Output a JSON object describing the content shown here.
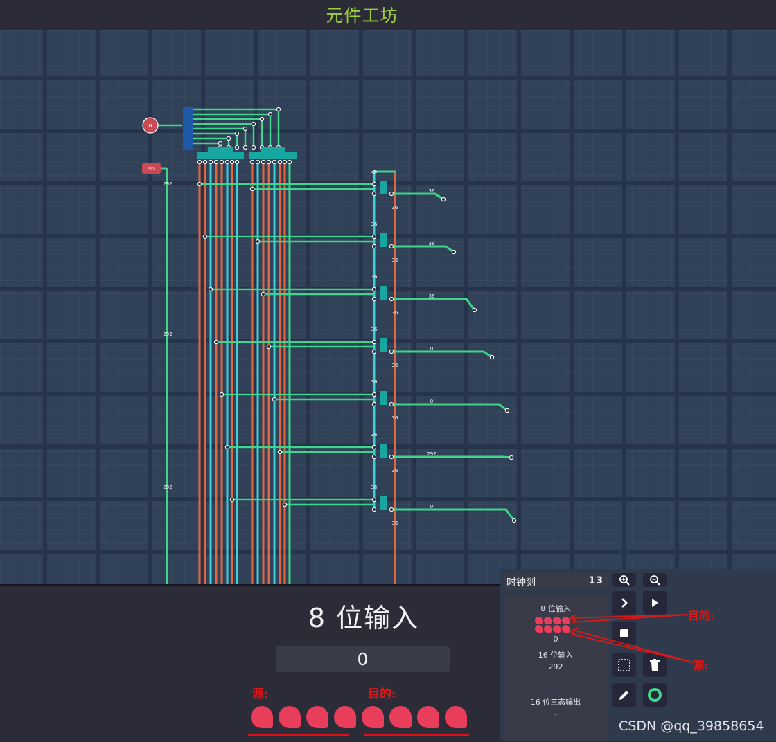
{
  "window": {
    "title": "元件工坊"
  },
  "circuit": {
    "wire_labels": {
      "v292": [
        "292",
        "292",
        "292"
      ],
      "bus36": "36",
      "row_outputs": [
        "36",
        "36",
        "36",
        "0",
        "0",
        "292",
        "0"
      ],
      "top_zero": "0"
    },
    "pins": {
      "in_h": "H",
      "in_low": "3l0",
      "out_zero": "0",
      "swc": "SWC"
    },
    "colors": {
      "orange": "#e2663f",
      "green": "#3dd68c",
      "cyan": "#3cd0d8",
      "pin": "#c94a55"
    }
  },
  "panel": {
    "component_title": "8 位输入",
    "value": "0",
    "note_source": "源:",
    "note_dest": "目的:",
    "bit_count": 8
  },
  "sidebar": {
    "clock_label": "时钟刻",
    "clock_value": "13",
    "items": [
      {
        "label": "8 位输入",
        "value": "0"
      },
      {
        "label": "16 位输入",
        "value": "292"
      },
      {
        "label": "16 位三态输出",
        "value": "-"
      }
    ],
    "buttons": [
      "zoom-in-icon",
      "zoom-out-icon",
      "step-icon",
      "play-icon",
      "stop-icon",
      "select-icon",
      "delete-icon",
      "pencil-icon",
      "ring-icon"
    ]
  },
  "annotations": {
    "dest": "目的:",
    "source": "源:"
  },
  "watermark": "CSDN @qq_39858654"
}
